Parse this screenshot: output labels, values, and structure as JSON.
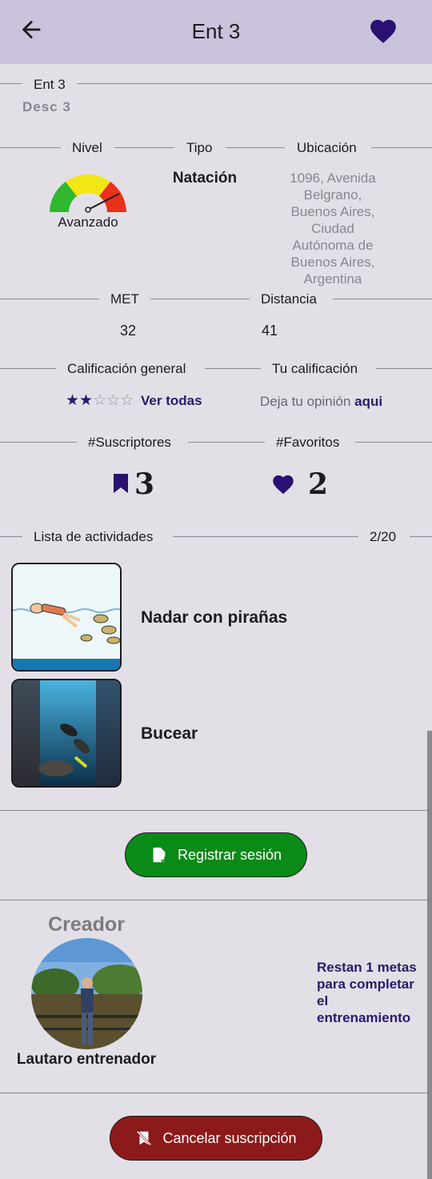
{
  "appbar": {
    "title": "Ent 3",
    "back_icon": "arrow-left-icon",
    "favorite_icon": "heart-icon"
  },
  "header": {
    "name": "Ent 3",
    "description": "Desc 3"
  },
  "details": {
    "nivel_label": "Nivel",
    "tipo_label": "Tipo",
    "ubicacion_label": "Ubicación",
    "nivel_value": "Avanzado",
    "tipo_value": "Natación",
    "ubicacion_value": "1096, Avenida Belgrano, Buenos Aires, Ciudad Autónoma de Buenos Aires, Argentina"
  },
  "metrics": {
    "met_label": "MET",
    "met_value": "32",
    "distancia_label": "Distancia",
    "distancia_value": "41"
  },
  "ratings": {
    "general_label": "Calificación general",
    "general_stars": 2,
    "general_max": 5,
    "ver_todas": "Ver todas",
    "tu_label": "Tu calificación",
    "tu_prompt": "Deja tu opinión",
    "tu_link": "aqui"
  },
  "counts": {
    "suscriptores_label": "#Suscriptores",
    "suscriptores_value": "3",
    "favoritos_label": "#Favoritos",
    "favoritos_value": "2"
  },
  "activities": {
    "label": "Lista de actividades",
    "count": "2/20",
    "items": [
      {
        "name": "Nadar con pirañas"
      },
      {
        "name": "Bucear"
      }
    ]
  },
  "actions": {
    "register_label": "Registrar sesión",
    "cancel_label": "Cancelar suscripción"
  },
  "creator": {
    "title": "Creador",
    "name": "Lautaro entrenador",
    "goals_text": "Restan 1 metas para completar el entrenamiento"
  },
  "colors": {
    "appbar": "#cbc2dc",
    "background": "#e2dfe6",
    "accent": "#2a1a6b",
    "green_button": "#0a8a17",
    "red_button": "#8c1a1a"
  }
}
